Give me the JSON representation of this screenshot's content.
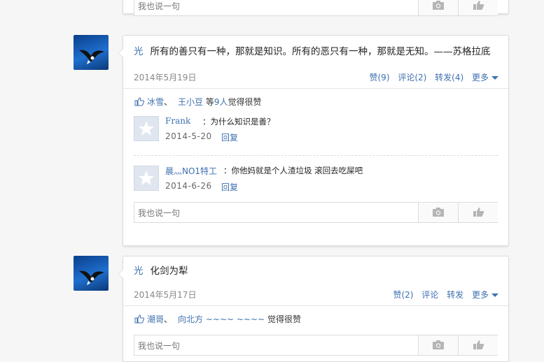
{
  "top_reply": {
    "placeholder": "我也说一句"
  },
  "posts": [
    {
      "author": "光",
      "text": "所有的善只有一种，那就是知识。所有的恶只有一种，那就是无知。——苏格拉底",
      "date": "2014年5月19日",
      "actions": {
        "like": "赞(9)",
        "comment": "评论(2)",
        "share": "转发(4)",
        "more": "更多"
      },
      "likes": {
        "names": [
          "冰雪",
          "王小豆"
        ],
        "sep": "、",
        "mid": " 等",
        "count": "9人",
        "suffix": "觉得很赞"
      },
      "comments": [
        {
          "name": "Frank",
          "text": "：为什么知识是善？",
          "date": "2014-5-20",
          "reply": "回复"
        },
        {
          "name": "晨灬NO1特工",
          "text": "：你他妈就是个人渣垃圾 滚回去吃屎吧",
          "date": "2014-6-26",
          "reply": "回复"
        }
      ],
      "reply_placeholder": "我也说一句"
    },
    {
      "author": "光",
      "text": "化剑为犁",
      "date": "2014年5月17日",
      "actions": {
        "like": "赞(2)",
        "comment": "评论",
        "share": "转发",
        "more": "更多"
      },
      "likes": {
        "names": [
          "潮哥",
          "向北方 ~~~~ ~~~~"
        ],
        "sep": "、",
        "mid": " ",
        "count": "",
        "suffix": "觉得很赞"
      },
      "reply_placeholder": "我也说一句"
    }
  ],
  "icons": {
    "camera": "camera-icon",
    "thumb": "thumb-icon",
    "like": "like-icon"
  },
  "colors": {
    "link": "#3e70b0",
    "background": "#f6f6f6"
  }
}
